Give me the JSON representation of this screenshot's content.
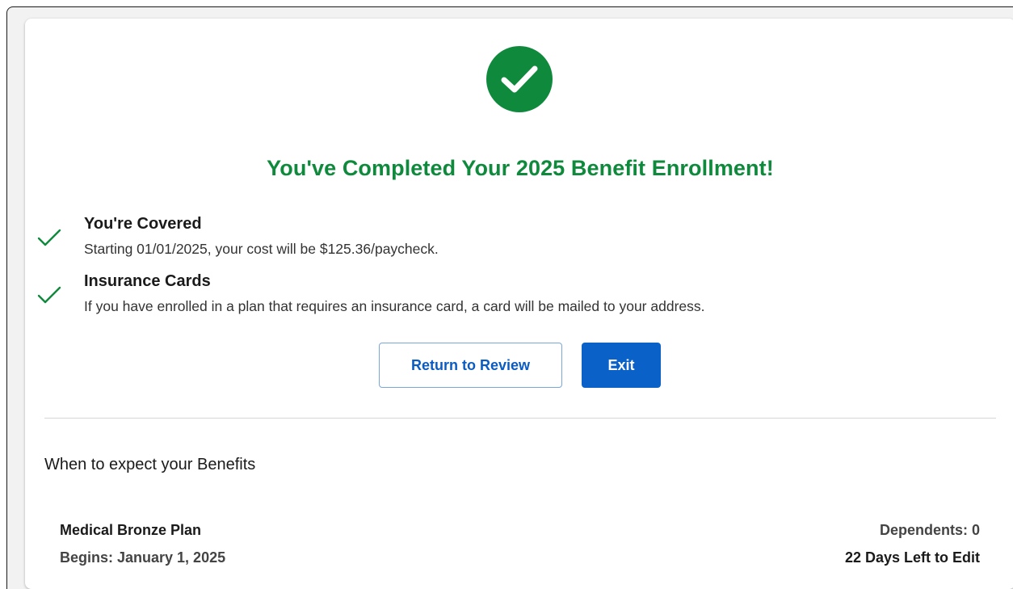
{
  "colors": {
    "success": "#0f8a3d",
    "primary": "#0a62c9",
    "outline_text": "#0a5cc2"
  },
  "confirmation": {
    "icon": "check-circle-icon",
    "headline": "You've Completed Your 2025 Benefit Enrollment!"
  },
  "status_items": [
    {
      "icon": "checkmark-icon",
      "title": "You're Covered",
      "description": "Starting 01/01/2025, your cost will be $125.36/paycheck."
    },
    {
      "icon": "checkmark-icon",
      "title": "Insurance Cards",
      "description": "If you have enrolled in a plan that requires an insurance card, a card will be mailed to your address."
    }
  ],
  "actions": {
    "return_label": "Return to Review",
    "exit_label": "Exit"
  },
  "benefits": {
    "section_title": "When to expect your Benefits",
    "plans": [
      {
        "name": "Medical Bronze Plan",
        "begins": "Begins: January 1, 2025",
        "dependents": "Dependents: 0",
        "days_left": "22 Days Left to Edit"
      }
    ]
  }
}
